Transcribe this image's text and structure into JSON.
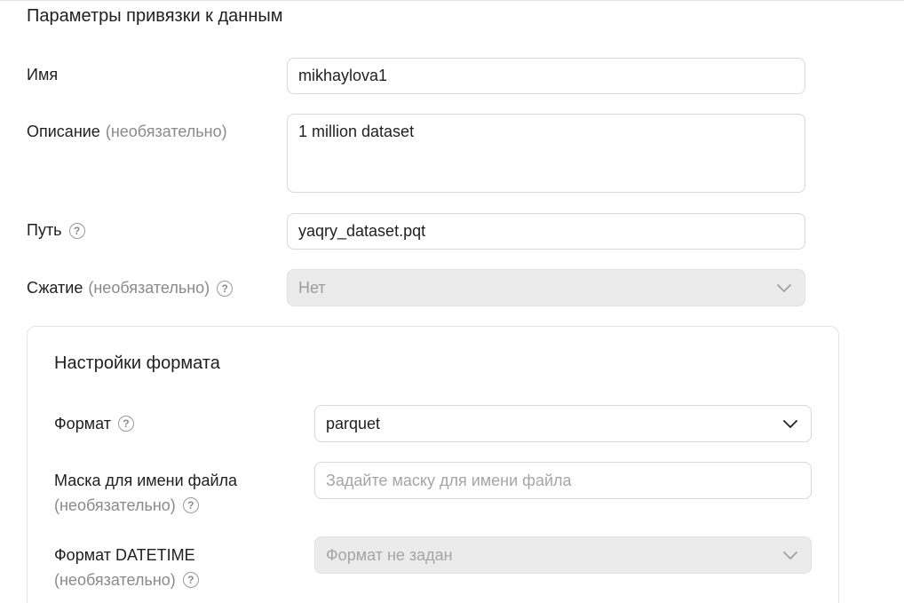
{
  "section": {
    "title": "Параметры привязки к данным"
  },
  "name_row": {
    "label": "Имя",
    "value": "mikhaylova1"
  },
  "description_row": {
    "label": "Описание",
    "optional": "(необязательно)",
    "value": "1 million dataset"
  },
  "path_row": {
    "label": "Путь",
    "help_icon": "question-circle-icon",
    "value": "yaqry_dataset.pqt"
  },
  "compression_row": {
    "label": "Сжатие",
    "optional": "(необязательно)",
    "help_icon": "question-circle-icon",
    "value": "Нет",
    "dropdown_icon": "chevron-down-icon"
  },
  "format_settings": {
    "title": "Настройки формата",
    "format": {
      "label": "Формат",
      "help_icon": "question-circle-icon",
      "value": "parquet",
      "dropdown_icon": "chevron-down-icon"
    },
    "file_mask": {
      "label": "Маска для имени файла",
      "optional": "(необязательно)",
      "help_icon": "question-circle-icon",
      "placeholder": "Задайте маску для имени файла"
    },
    "datetime_format": {
      "label": "Формат DATETIME",
      "optional": "(необязательно)",
      "help_icon": "question-circle-icon",
      "value": "Формат не задан",
      "dropdown_icon": "chevron-down-icon"
    }
  },
  "colors": {
    "text": "#1f1f1f",
    "muted": "#8a8a8a",
    "border": "#d7d7d7",
    "disabled_bg": "#ebebeb"
  }
}
